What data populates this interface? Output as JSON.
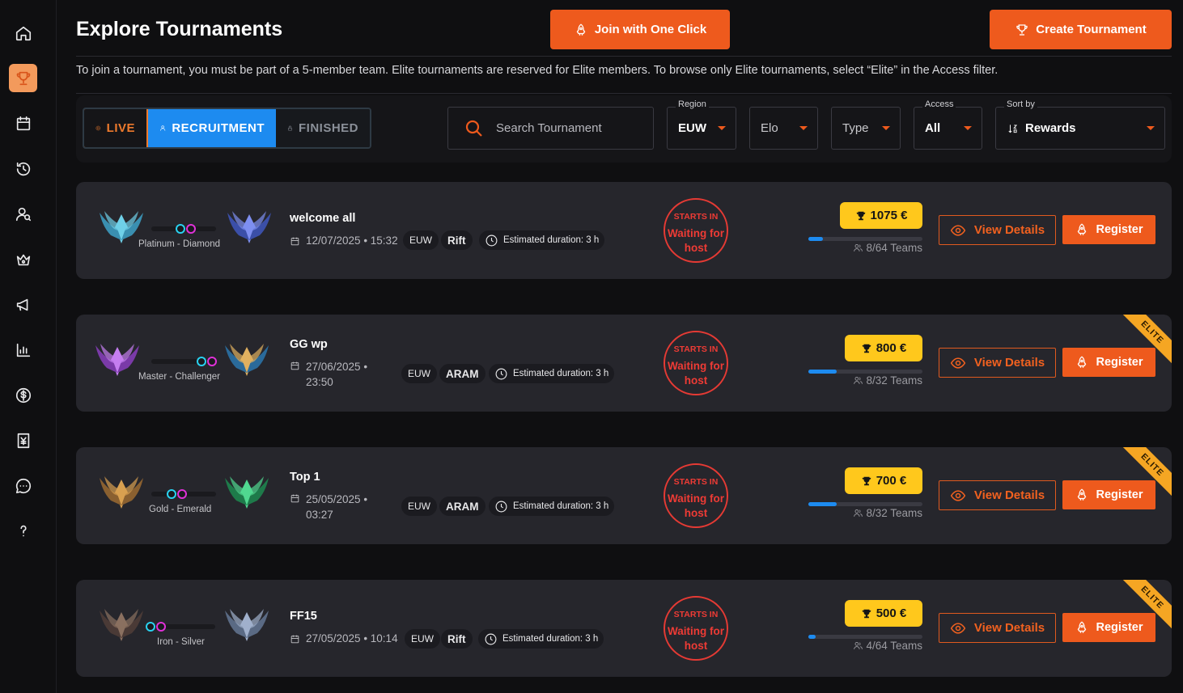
{
  "page": {
    "title": "Explore Tournaments",
    "join_label": "Join with One Click",
    "create_label": "Create Tournament",
    "info": "To join a tournament, you must be part of a 5-member team. Elite tournaments are reserved for Elite members. To browse only Elite tournaments, select “Elite” in the Access filter."
  },
  "sidebar": {
    "items": [
      {
        "icon": "home-icon"
      },
      {
        "icon": "trophy-icon",
        "active": true
      },
      {
        "icon": "calendar-icon"
      },
      {
        "icon": "history-icon"
      },
      {
        "icon": "user-search-icon"
      },
      {
        "icon": "crown-icon"
      },
      {
        "icon": "megaphone-icon"
      },
      {
        "icon": "bar-chart-icon"
      },
      {
        "icon": "dollar-icon"
      },
      {
        "icon": "voucher-icon"
      },
      {
        "icon": "chat-icon"
      },
      {
        "icon": "help-icon"
      }
    ]
  },
  "filters": {
    "status_tabs": [
      "LIVE",
      "RECRUITMENT",
      "FINISHED"
    ],
    "active_tab": "RECRUITMENT",
    "search_placeholder": "Search Tournament",
    "region": {
      "label": "Region",
      "value": "EUW"
    },
    "elo": {
      "value": "Elo"
    },
    "type": {
      "value": "Type"
    },
    "access": {
      "label": "Access",
      "value": "All"
    },
    "sort": {
      "label": "Sort by",
      "value": "Rewards"
    }
  },
  "tournaments": [
    {
      "name": "welcome all",
      "date": "12/07/2025 • 15:32",
      "region": "EUW",
      "mode": "Rift",
      "duration": "Estimated duration: 3 h",
      "elo_range": "Platinum - Diamond",
      "starts_in_label": "STARTS IN",
      "status": "Waiting for host",
      "reward": "1075 €",
      "teams": "8/64 Teams",
      "team_fill": 0.125,
      "elite": false,
      "elite_label": "",
      "view_label": "View Details",
      "register_label": "Register"
    },
    {
      "name": "GG wp",
      "date": "27/06/2025 • 23:50",
      "region": "EUW",
      "mode": "ARAM",
      "duration": "Estimated duration: 3 h",
      "elo_range": "Master - Challenger",
      "starts_in_label": "STARTS IN",
      "status": "Waiting for host",
      "reward": "800 €",
      "teams": "8/32 Teams",
      "team_fill": 0.25,
      "elite": true,
      "elite_label": "ELITE",
      "view_label": "View Details",
      "register_label": "Register"
    },
    {
      "name": "Top 1",
      "date": "25/05/2025 • 03:27",
      "region": "EUW",
      "mode": "ARAM",
      "duration": "Estimated duration: 3 h",
      "elo_range": "Gold - Emerald",
      "starts_in_label": "STARTS IN",
      "status": "Waiting for host",
      "reward": "700 €",
      "teams": "8/32 Teams",
      "team_fill": 0.25,
      "elite": true,
      "elite_label": "ELITE",
      "view_label": "View Details",
      "register_label": "Register"
    },
    {
      "name": "FF15",
      "date": "27/05/2025 • 10:14",
      "region": "EUW",
      "mode": "Rift",
      "duration": "Estimated duration: 3 h",
      "elo_range": "Iron - Silver",
      "starts_in_label": "STARTS IN",
      "status": "Waiting for host",
      "reward": "500 €",
      "teams": "4/64 Teams",
      "team_fill": 0.0625,
      "elite": true,
      "elite_label": "ELITE",
      "view_label": "View Details",
      "register_label": "Register"
    }
  ],
  "colors": {
    "accent": "#ee5a1d",
    "recruit_blue": "#1d8bf0",
    "reward_gold": "#ffc81c",
    "status_red": "#ee3b35",
    "elite_ribbon": "#f5a623"
  }
}
